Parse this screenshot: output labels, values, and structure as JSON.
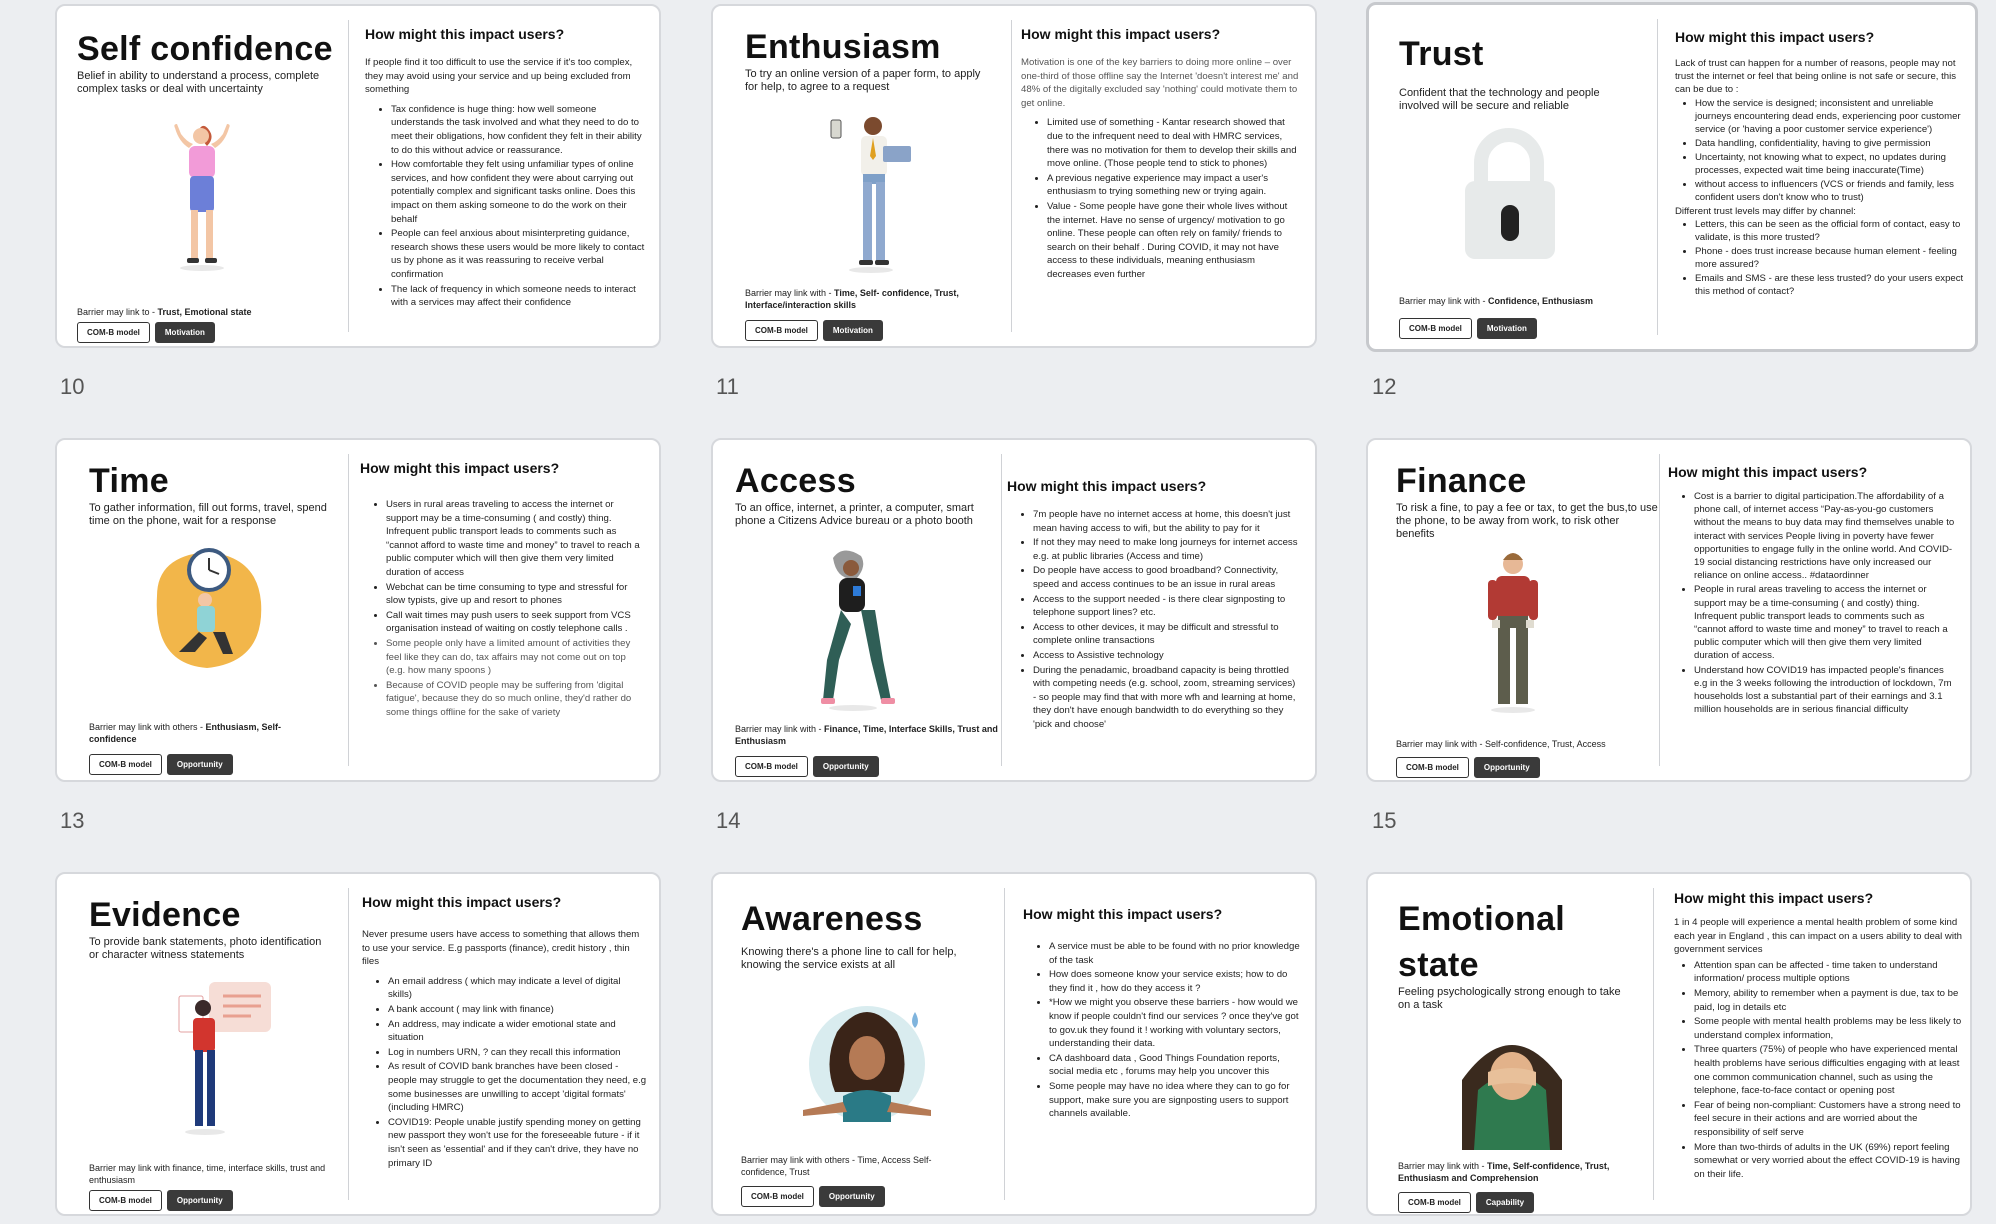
{
  "slide_numbers": [
    "10",
    "11",
    "12",
    "13",
    "14",
    "15"
  ],
  "tag_com_b": "COM-B model",
  "cards": [
    {
      "title": "Self confidence",
      "subtitle": "Belief in ability to understand a process, complete complex tasks or deal with uncertainty",
      "heading": "How might this impact users?",
      "barrier_prefix": "Barrier may link to - ",
      "barrier_bold": "Trust, Emotional state",
      "tag": "Motivation",
      "intro": "If people find it too difficult to use the service if it's too complex, they may avoid using your service and up being excluded from something",
      "bullets": [
        "Tax confidence is huge thing: how well someone understands the task involved and what they need to do to meet their obligations, how confident they felt in their ability to do this without advice or reassurance.",
        "How comfortable they felt using unfamiliar types of online services, and how confident they were about carrying out potentially complex and significant tasks online. Does this impact on them asking someone to do the work on their behalf",
        "People can feel anxious about misinterpreting guidance, research shows these users would be more likely to contact us by phone as it was reassuring to receive verbal confirmation",
        "The lack of frequency in which someone needs to interact with a services may affect their confidence"
      ]
    },
    {
      "title": "Enthusiasm",
      "subtitle": "To try an online version of a paper form, to apply for help, to agree to a request",
      "heading": "How might this impact users?",
      "barrier_prefix": "Barrier may link with - ",
      "barrier_bold": "Time, Self- confidence, Trust, Interface/interaction skills",
      "tag": "Motivation",
      "intro": "Motivation is one of the key barriers to doing more online – over one-third of those offline say the Internet 'doesn't interest me' and 48% of the digitally excluded say 'nothing' could motivate them to get online.",
      "bullets": [
        "Limited use of something - Kantar research showed that due to the infrequent need to deal with HMRC services, there was no motivation for them to develop their skills and move online. (Those people tend to stick to phones)",
        "A previous negative experience may impact a user's enthusiasm to trying something new or trying again.",
        "Value - Some people have gone their whole lives without the internet. Have no sense of urgency/ motivation to go online. These people can often rely on family/ friends to search on their behalf . During COVID, it may not have access to these individuals, meaning enthusiasm decreases even further"
      ]
    },
    {
      "title": "Trust",
      "subtitle": "Confident that the technology and people involved will be secure and reliable",
      "heading": "How might this impact users?",
      "barrier_prefix": "Barrier may link with - ",
      "barrier_bold": "Confidence, Enthusiasm",
      "tag": "Motivation",
      "intro": "Lack of trust can happen for a number of reasons, people may not trust the internet or feel that being online is not safe or secure, this can be due to :",
      "bullets": [
        "How the service is designed; inconsistent and unreliable journeys encountering dead ends, experiencing poor customer service (or 'having a poor customer service experience')",
        "Data handling, confidentiality, having to give permission",
        "Uncertainty, not knowing what to expect, no updates during processes, expected wait time being inaccurate(Time)",
        "without access to influencers (VCS or friends and family, less confident users don't know who to trust)"
      ],
      "mid": "Different trust levels may differ by channel:",
      "bullets2": [
        "Letters, this can be seen as the official form of contact, easy to validate, is this more trusted?",
        "Phone - does trust increase because human element - feeling more assured?",
        "Emails and SMS - are these less trusted? do your users expect this method of contact?"
      ]
    },
    {
      "title": "Time",
      "subtitle": "To gather information, fill out forms, travel, spend time on the phone, wait for a response",
      "heading": "How might this impact users?",
      "barrier_prefix": "Barrier may link with others - ",
      "barrier_bold": "Enthusiasm, Self-confidence",
      "tag": "Opportunity",
      "bullets": [
        "Users in rural areas traveling to access the internet or support may be a time-consuming ( and costly) thing. Infrequent public transport leads to comments such as “cannot afford to waste time and money” to travel to reach a public computer which will then give them very limited duration of access",
        "Webchat can be time consuming to type and stressful for slow typists, give up and resort to phones",
        "Call wait times may push users to seek support from VCS organisation instead of waiting on costly telephone calls .",
        "Some people only have a limited amount of activities they feel like they can do, tax affairs may not come out on top  (e.g. how many spoons )",
        "Because of COVID people may be suffering from 'digital fatigue', because they do so much online, they'd rather do some things offline for the sake of variety"
      ]
    },
    {
      "title": "Access",
      "subtitle": "To an office, internet, a printer, a computer, smart phone a Citizens Advice bureau or a photo booth",
      "heading": "How might this impact users?",
      "barrier_prefix": "Barrier may link with  -  ",
      "barrier_bold": "Finance, Time, Interface Skills, Trust and Enthusiasm",
      "tag": "Opportunity",
      "bullets": [
        "7m people have no internet access at home, this doesn't just mean having access to wifi, but the ability to pay for it",
        "If not they may need to make long journeys for internet access e.g. at public libraries (Access and time)",
        "Do people have access to good broadband? Connectivity, speed and access continues to be an issue in rural areas",
        "Access to the support needed - is there clear signposting to telephone support lines? etc.",
        "Access to other devices, it may be difficult and stressful to complete online transactions",
        "Access to Assistive technology",
        "During the penadamic, broadband capacity is being throttled with competing needs (e.g. school, zoom, streaming services) - so people may find that with more wfh and learning at home, they don't have enough bandwidth to do everything so they 'pick and choose'"
      ]
    },
    {
      "title": "Finance",
      "subtitle": "To risk a fine, to pay a fee or tax, to get the bus,to use the phone, to be away from work, to risk other benefits",
      "heading": "How might this impact users?",
      "barrier_prefix": "Barrier may link with -  ",
      "barrier_bold": "Self-confidence, Trust, Access",
      "tag": "Opportunity",
      "bullets": [
        "Cost is a barrier to digital participation.The affordability of a phone call, of internet access “Pay-as-you-go customers without the means to buy data may find themselves unable to interact with services People living in poverty have fewer opportunities to engage fully in the online world. And COVID-19 social distancing restrictions have only increased our reliance on online access.. #dataordinner",
        "People in rural areas traveling to access the internet or support may be a time-consuming ( and costly) thing. Infrequent public transport leads to comments such as “cannot afford to waste time and money” to travel to reach a public computer which will then give them very limited duration of access.",
        "Understand how COVID19 has impacted people's finances e.g in the 3 weeks following the introduction of lockdown, 7m households lost a substantial part of their earnings and 3.1 million households are in serious financial difficulty"
      ]
    },
    {
      "title": "Evidence",
      "subtitle": "To provide bank statements, photo identification or character witness statements",
      "heading": "How might this impact users?",
      "barrier_prefix": "Barrier may link with finance, time, interface skills, trust and enthusiasm",
      "barrier_bold": "",
      "tag": "Opportunity",
      "intro": "Never presume users have access to something that allows them to use your service. E.g passports (finance), credit history ,  thin files",
      "bullets": [
        "An email address ( which may indicate a level of digital skills)",
        "A bank account ( may link with finance)",
        "An address, may indicate a wider emotional state and situation",
        "Log in numbers URN, ? can they recall this information",
        "As result of COVID  bank branches have been closed - people may struggle to get the documentation they need, e.g some businesses are unwilling to accept 'digital formats' (including HMRC)",
        "COVID19: People unable justify spending money on getting new passport they won't use for the foreseeable future - if it isn't seen as 'essential' and if they can't drive, they have no primary ID"
      ]
    },
    {
      "title": "Awareness",
      "subtitle": "Knowing there's a phone line to call for help, knowing the service exists at all",
      "heading": "How might this impact users?",
      "barrier_prefix": "Barrier may link with others -  Time, Access Self-confidence, Trust",
      "barrier_bold": "",
      "tag": "Opportunity",
      "bullets": [
        "A service must be able to be found with no prior knowledge of the task",
        "How does someone know your service exists; how to do they find it , how do they access it ?",
        "*How we might you observe these barriers - how would we know if people couldn't find our services ? once they've got to gov.uk they found it ! working with voluntary sectors, understanding their data.",
        "CA dashboard data , Good Things Foundation reports, social media etc , forums may help you uncover this",
        "Some people may have no idea where they can to go for support, make sure you are signposting users to support channels available."
      ]
    },
    {
      "title": "Emotional state",
      "subtitle": "Feeling psychologically strong enough to take on a task",
      "heading": "How might this impact users?",
      "barrier_prefix": "Barrier may link with - ",
      "barrier_bold": "Time, Self-confidence, Trust, Enthusiasm and Comprehension",
      "tag": "Capability",
      "intro": "1 in 4 people will experience a mental health problem of some kind each year in England , this can impact on a users ability to deal with government services",
      "bullets": [
        "Attention span can be affected - time taken to understand information/ process multiple options",
        "Memory, ability to remember when a payment is due, tax to be paid, log in details etc",
        "Some people with mental health problems may be less likely to understand complex information,",
        "Three quarters (75%) of people who have experienced mental health problems have serious difficulties engaging with at least one common communication channel, such as using the telephone, face-to-face contact or opening post",
        "Fear of being non-compliant: Customers have a strong need to feel secure in their actions and are worried about the responsibility of self serve",
        "More than two-thirds of adults in the UK (69%) report feeling somewhat or very worried about the effect COVID-19 is having on their life."
      ]
    }
  ]
}
